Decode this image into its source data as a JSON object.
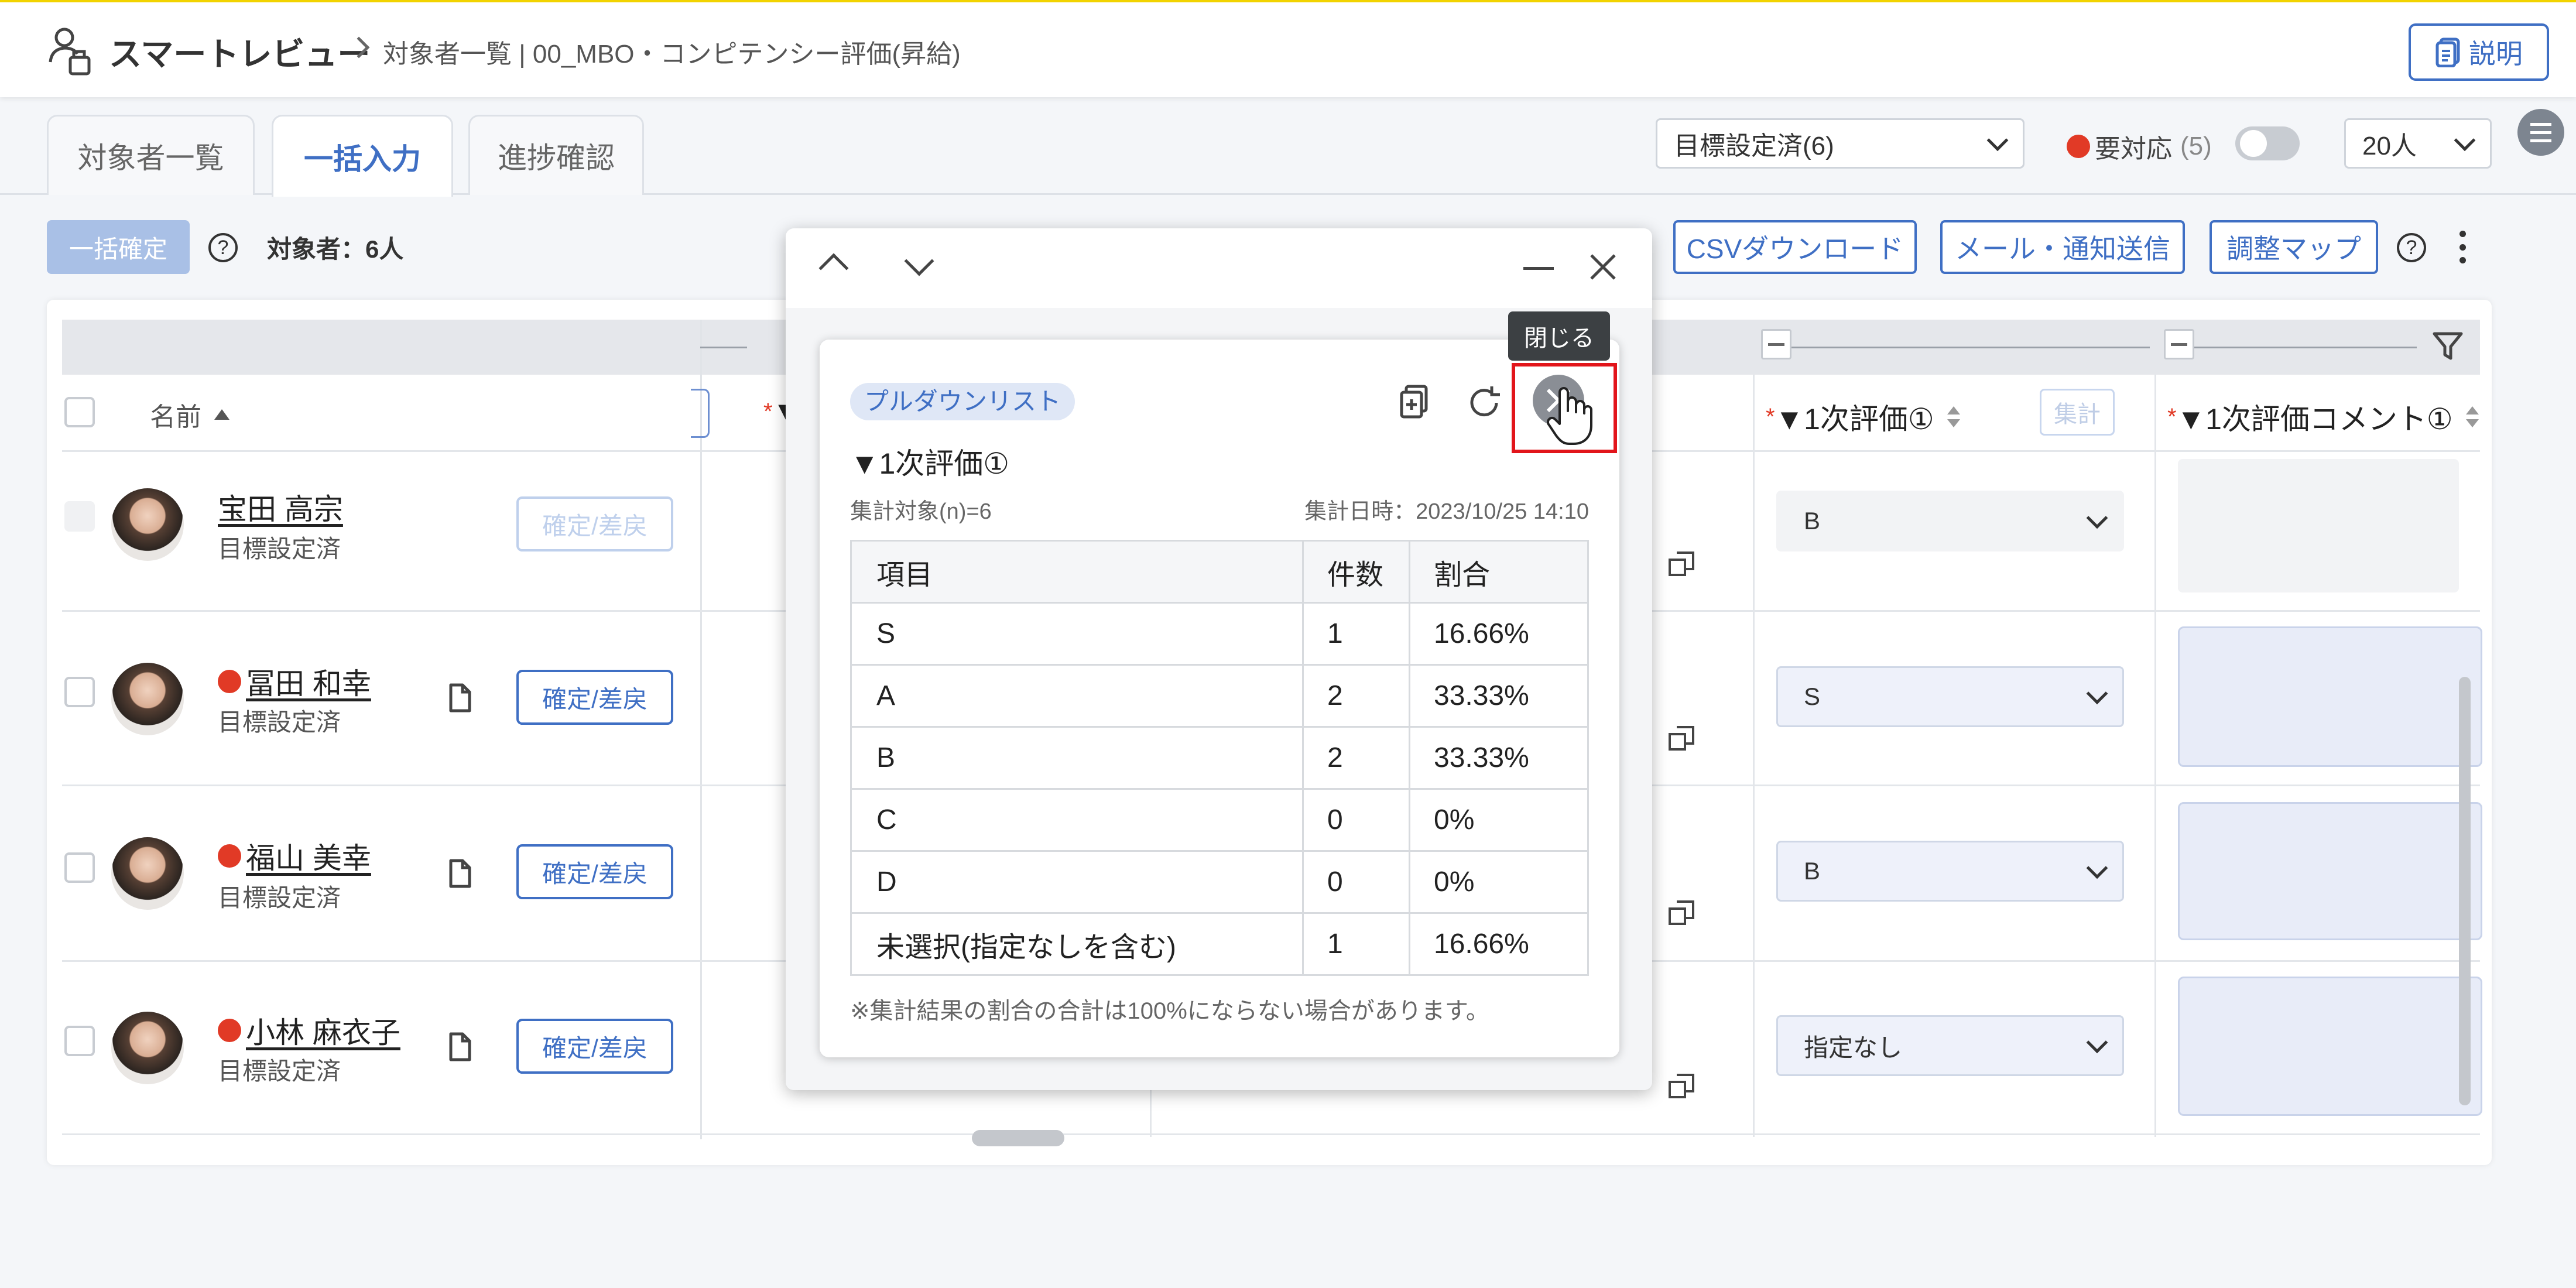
{
  "header": {
    "app_title": "スマートレビュー",
    "breadcrumb": "対象者一覧 | 00_MBO・コンピテンシー評価(昇給)",
    "help_label": "説明"
  },
  "tabs": [
    {
      "label": "対象者一覧"
    },
    {
      "label": "一括入力"
    },
    {
      "label": "進捗確認"
    }
  ],
  "filters": {
    "status_select": "目標設定済(6)",
    "attention_label": "要対応",
    "attention_count": "(5)",
    "page_size": "20人"
  },
  "toolbar": {
    "bulk_confirm": "一括確定",
    "target_count": "対象者：6人",
    "csv": "CSVダウンロード",
    "mail": "メール・通知送信",
    "adjust": "調整マップ"
  },
  "table": {
    "name_header": "名前",
    "col_eval": "▼1次評価①",
    "col_comment": "▼1次評価コメント①",
    "col_mark": "▼",
    "sum_btn": "集計",
    "rows": [
      {
        "name": "宝田 高宗",
        "status": "目標設定済",
        "action": "確定/差戻",
        "grade": "B",
        "attention": false
      },
      {
        "name": "冨田 和幸",
        "status": "目標設定済",
        "action": "確定/差戻",
        "grade": "S",
        "attention": true
      },
      {
        "name": "福山 美幸",
        "status": "目標設定済",
        "action": "確定/差戻",
        "grade": "B",
        "attention": true
      },
      {
        "name": "小林 麻衣子",
        "status": "目標設定済",
        "action": "確定/差戻",
        "grade": "指定なし",
        "attention": true
      }
    ]
  },
  "popup": {
    "tooltip": "閉じる",
    "tag": "プルダウンリスト",
    "title": "▼1次評価①",
    "n_label": "集計対象(n)=6",
    "date_label": "集計日時：2023/10/25 14:10",
    "headers": [
      "項目",
      "件数",
      "割合"
    ],
    "rows": [
      {
        "item": "S",
        "count": "1",
        "ratio": "16.66%"
      },
      {
        "item": "A",
        "count": "2",
        "ratio": "33.33%"
      },
      {
        "item": "B",
        "count": "2",
        "ratio": "33.33%"
      },
      {
        "item": "C",
        "count": "0",
        "ratio": "0%"
      },
      {
        "item": "D",
        "count": "0",
        "ratio": "0%"
      },
      {
        "item": "未選択(指定なしを含む)",
        "count": "1",
        "ratio": "16.66%"
      }
    ],
    "note": "※集計結果の割合の合計は100%にならない場合があります。"
  },
  "colors": {
    "accent": "#3f6fc4",
    "attention": "#e13a26",
    "highlight": "#e2151b",
    "topbar_line": "#f2d300"
  }
}
